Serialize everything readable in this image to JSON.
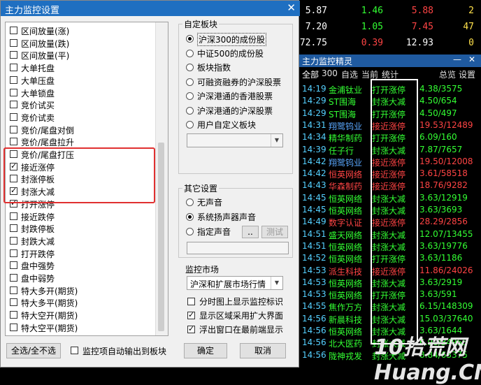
{
  "dialog": {
    "title": "主力监控设置",
    "close": "✕",
    "list_items": [
      {
        "label": "区间放量(涨)",
        "checked": false
      },
      {
        "label": "区间放量(跌)",
        "checked": false
      },
      {
        "label": "区间放量(平)",
        "checked": false
      },
      {
        "label": "大单托盘",
        "checked": false
      },
      {
        "label": "大单压盘",
        "checked": false
      },
      {
        "label": "大单锁盘",
        "checked": false
      },
      {
        "label": "竞价试买",
        "checked": false
      },
      {
        "label": "竞价试卖",
        "checked": false
      },
      {
        "label": "竞价/尾盘对倒",
        "checked": false
      },
      {
        "label": "竞价/尾盘拉升",
        "checked": false
      },
      {
        "label": "竞价/尾盘打压",
        "checked": false
      },
      {
        "label": "接近涨停",
        "checked": true
      },
      {
        "label": "封涨停板",
        "checked": false
      },
      {
        "label": "封涨大减",
        "checked": true
      },
      {
        "label": "打开涨停",
        "checked": true
      },
      {
        "label": "接近跌停",
        "checked": false
      },
      {
        "label": "封跌停板",
        "checked": false
      },
      {
        "label": "封跌大减",
        "checked": false
      },
      {
        "label": "打开跌停",
        "checked": false
      },
      {
        "label": "盘中强势",
        "checked": false
      },
      {
        "label": "盘中弱势",
        "checked": false
      },
      {
        "label": "特大多开(期货)",
        "checked": false
      },
      {
        "label": "特大多平(期货)",
        "checked": false
      },
      {
        "label": "特大空开(期货)",
        "checked": false
      },
      {
        "label": "特大空平(期货)",
        "checked": false
      }
    ],
    "custom_block": {
      "title": "自定板块",
      "options": [
        "沪深300的成份股",
        "中证500的成份股",
        "板块指数",
        "可融资融券的沪深股票",
        "沪深港通的香港股票",
        "沪深港通的沪深股票",
        "用户自定义板块"
      ],
      "selected_index": 0,
      "user_block_value": ""
    },
    "other_settings": {
      "title": "其它设置",
      "options": [
        "无声音",
        "系统扬声器声音",
        "指定声音"
      ],
      "selected_index": 1,
      "browse_label": "..",
      "test_label": "测试",
      "sound_path": ""
    },
    "market": {
      "title": "监控市场",
      "value": "沪深和扩展市场行情"
    },
    "checks": [
      {
        "label": "分时图上显示监控标识",
        "checked": false
      },
      {
        "label": "显示区域采用扩大界面",
        "checked": true
      },
      {
        "label": "浮出窗口在最前端显示",
        "checked": true
      }
    ],
    "select_all_label": "全选/全不选",
    "auto_export_label": "监控项自动输出到板块",
    "auto_export_checked": false,
    "ok_label": "确定",
    "cancel_label": "取消"
  },
  "bg_rows": [
    {
      "a": "5.87",
      "b": "1.46",
      "c": "5.88",
      "d": "2",
      "bcol": "#33ff33",
      "ccol": "#ff4444"
    },
    {
      "a": "7.20",
      "b": "1.05",
      "c": "7.45",
      "d": "47",
      "bcol": "#33ff33",
      "ccol": "#ff4444"
    },
    {
      "a": "72.75",
      "b": "0.39",
      "c": "12.93",
      "d": "0",
      "bcol": "#ff4444",
      "ccol": "#ffffff"
    }
  ],
  "monitor": {
    "title": "主力监控精灵",
    "minimize": "—",
    "close": "✕",
    "tabs": [
      "全部",
      "300",
      "自选",
      "当前",
      "统计"
    ],
    "right_tabs": [
      "总览",
      "设置"
    ],
    "rows": [
      {
        "time": "14:19",
        "name": "金浦钛业",
        "event": "打开涨停",
        "info": "4.38/3575",
        "ncol": "#33ff33",
        "ecol": "#33ff33",
        "icol": "#33ff33"
      },
      {
        "time": "14:29",
        "name": "ST围海",
        "event": "封涨大减",
        "info": "4.50/654",
        "ncol": "#33ff33",
        "ecol": "#33ff33",
        "icol": "#33ff33"
      },
      {
        "time": "14:29",
        "name": "ST围海",
        "event": "打开涨停",
        "info": "4.50/497",
        "ncol": "#33ff33",
        "ecol": "#33ff33",
        "icol": "#33ff33"
      },
      {
        "time": "14:31",
        "name": "翔鹭钨业",
        "event": "接近涨停",
        "info": "19.53/12489",
        "ncol": "#5aa8ff",
        "ecol": "#ff4444",
        "icol": "#ff4444"
      },
      {
        "time": "14:34",
        "name": "精华制药",
        "event": "打开涨停",
        "info": "6.09/160",
        "ncol": "#33ff33",
        "ecol": "#33ff33",
        "icol": "#33ff33"
      },
      {
        "time": "14:39",
        "name": "任子行",
        "event": "封涨大减",
        "info": "7.87/7657",
        "ncol": "#33ff33",
        "ecol": "#33ff33",
        "icol": "#33ff33"
      },
      {
        "time": "14:42",
        "name": "翔鹭钨业",
        "event": "接近涨停",
        "info": "19.50/12008",
        "ncol": "#5aa8ff",
        "ecol": "#ff4444",
        "icol": "#ff4444"
      },
      {
        "time": "14:42",
        "name": "恒英网络",
        "event": "接近涨停",
        "info": "3.61/58518",
        "ncol": "#ff4444",
        "ecol": "#ff4444",
        "icol": "#ff4444"
      },
      {
        "time": "14:43",
        "name": "华森制药",
        "event": "接近涨停",
        "info": "18.76/9282",
        "ncol": "#ff4444",
        "ecol": "#ff4444",
        "icol": "#ff4444"
      },
      {
        "time": "14:45",
        "name": "恒英网络",
        "event": "封涨大减",
        "info": "3.63/12919",
        "ncol": "#33ff33",
        "ecol": "#33ff33",
        "icol": "#33ff33"
      },
      {
        "time": "14:45",
        "name": "恒英网络",
        "event": "封涨大减",
        "info": "3.63/3693",
        "ncol": "#33ff33",
        "ecol": "#33ff33",
        "icol": "#33ff33"
      },
      {
        "time": "14:49",
        "name": "数字认证",
        "event": "接近涨停",
        "info": "28.29/2856",
        "ncol": "#ff4444",
        "ecol": "#ff4444",
        "icol": "#ff4444"
      },
      {
        "time": "14:51",
        "name": "盛天网络",
        "event": "封涨大减",
        "info": "12.07/13455",
        "ncol": "#33ff33",
        "ecol": "#33ff33",
        "icol": "#33ff33"
      },
      {
        "time": "14:51",
        "name": "恒英网络",
        "event": "封涨大减",
        "info": "3.63/19776",
        "ncol": "#33ff33",
        "ecol": "#33ff33",
        "icol": "#33ff33"
      },
      {
        "time": "14:52",
        "name": "恒英网络",
        "event": "打开涨停",
        "info": "3.63/1186",
        "ncol": "#33ff33",
        "ecol": "#33ff33",
        "icol": "#33ff33"
      },
      {
        "time": "14:53",
        "name": "派生科技",
        "event": "接近涨停",
        "info": "11.86/24026",
        "ncol": "#ff4444",
        "ecol": "#ff4444",
        "icol": "#ff4444"
      },
      {
        "time": "14:53",
        "name": "恒英网络",
        "event": "封涨大减",
        "info": "3.63/2919",
        "ncol": "#33ff33",
        "ecol": "#33ff33",
        "icol": "#33ff33"
      },
      {
        "time": "14:53",
        "name": "恒英网络",
        "event": "打开涨停",
        "info": "3.63/591",
        "ncol": "#33ff33",
        "ecol": "#33ff33",
        "icol": "#33ff33"
      },
      {
        "time": "14:55",
        "name": "焦作万方",
        "event": "封涨大减",
        "info": "6.15/148309",
        "ncol": "#33ff33",
        "ecol": "#33ff33",
        "icol": "#33ff33"
      },
      {
        "time": "14:56",
        "name": "新晨科技",
        "event": "封涨大减",
        "info": "15.03/37640",
        "ncol": "#33ff33",
        "ecol": "#33ff33",
        "icol": "#33ff33"
      },
      {
        "time": "14:56",
        "name": "恒英网络",
        "event": "封涨大减",
        "info": "3.63/1644",
        "ncol": "#33ff33",
        "ecol": "#33ff33",
        "icol": "#33ff33"
      },
      {
        "time": "14:56",
        "name": "北大医药",
        "event": "封涨大减",
        "info": "6.90/34955",
        "ncol": "#33ff33",
        "ecol": "#33ff33",
        "icol": "#33ff33"
      },
      {
        "time": "14:56",
        "name": "陇神戎发",
        "event": "封涨大减",
        "info": "8.84/63375",
        "ncol": "#33ff33",
        "ecol": "#33ff33",
        "icol": "#33ff33"
      }
    ]
  },
  "watermark": "10拾荒网 Huang.CN",
  "colors": {
    "title_blue": "#1f6fc1",
    "highlight_red": "#e03030",
    "up_red": "#ff4444",
    "down_green": "#33ff33",
    "time_cyan": "#55d0ff"
  }
}
